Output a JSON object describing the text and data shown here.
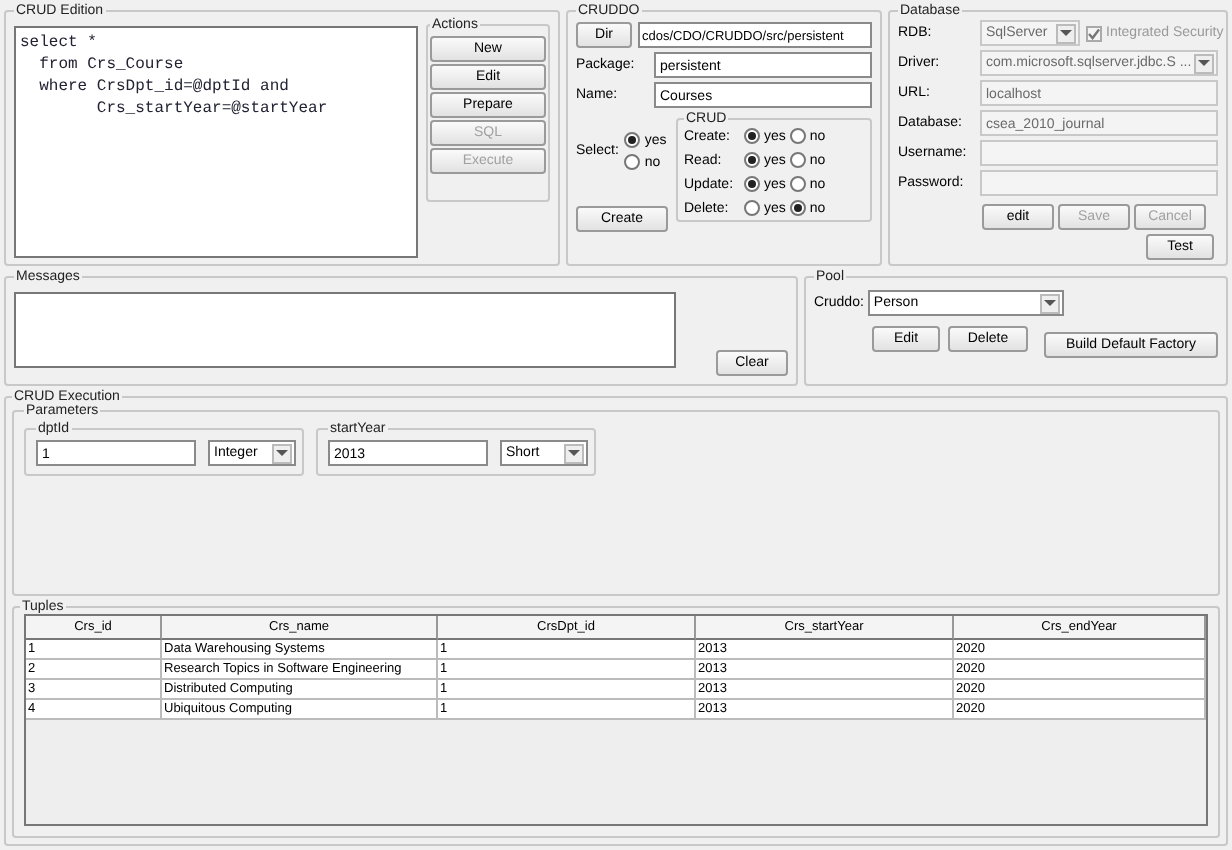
{
  "crud_edition": {
    "title": "CRUD Edition",
    "sql": [
      "select *",
      "  from Crs_Course",
      "  where CrsDpt_id=@dptId and",
      "        Crs_startYear=@startYear"
    ],
    "actions": {
      "title": "Actions",
      "buttons": [
        {
          "label": "New",
          "disabled": false
        },
        {
          "label": "Edit",
          "disabled": false
        },
        {
          "label": "Prepare",
          "disabled": false
        },
        {
          "label": "SQL",
          "disabled": true
        },
        {
          "label": "Execute",
          "disabled": true
        }
      ]
    }
  },
  "cruddo": {
    "title": "CRUDDO",
    "dir_button": "Dir",
    "dir_value": "cdos/CDO/CRUDDO/src/persistent",
    "fields": [
      {
        "label": "Package:",
        "value": "persistent"
      },
      {
        "label": "Name:",
        "value": "Courses"
      }
    ],
    "select": {
      "label": "Select:",
      "options": [
        {
          "label": "yes",
          "selected": true
        },
        {
          "label": "no",
          "selected": false
        }
      ]
    },
    "crud": {
      "title": "CRUD",
      "rows": [
        {
          "label": "Create:",
          "options": [
            {
              "label": "yes",
              "selected": true
            },
            {
              "label": "no",
              "selected": false
            }
          ]
        },
        {
          "label": "Read:",
          "options": [
            {
              "label": "yes",
              "selected": true
            },
            {
              "label": "no",
              "selected": false
            }
          ]
        },
        {
          "label": "Update:",
          "options": [
            {
              "label": "yes",
              "selected": true
            },
            {
              "label": "no",
              "selected": false
            }
          ]
        },
        {
          "label": "Delete:",
          "options": [
            {
              "label": "yes",
              "selected": false
            },
            {
              "label": "no",
              "selected": true
            }
          ]
        }
      ]
    },
    "create_button": "Create"
  },
  "database": {
    "title": "Database",
    "rdb": {
      "label": "RDB:",
      "value": "SqlServer",
      "disabled": true
    },
    "integrated_security": {
      "label": "Integrated Security",
      "checked": true,
      "disabled": true
    },
    "fields": [
      {
        "label": "Driver:",
        "value": "com.microsoft.sqlserver.jdbc.S ...",
        "kind": "select",
        "disabled": true
      },
      {
        "label": "URL:",
        "value": "localhost",
        "kind": "text",
        "disabled": true
      },
      {
        "label": "Database:",
        "value": "csea_2010_journal",
        "kind": "text",
        "disabled": true
      },
      {
        "label": "Username:",
        "kind": "text",
        "disabled": true
      },
      {
        "label": "Password:",
        "kind": "text",
        "disabled": true
      }
    ],
    "buttons": [
      {
        "label": "edit",
        "disabled": false
      },
      {
        "label": "Save",
        "disabled": true
      },
      {
        "label": "Cancel",
        "disabled": true
      }
    ],
    "test_button": "Test"
  },
  "messages": {
    "title": "Messages",
    "clear_button": "Clear"
  },
  "pool": {
    "title": "Pool",
    "label": "Cruddo:",
    "value": "Person",
    "buttons": [
      "Edit",
      "Delete"
    ],
    "build_button": "Build Default Factory"
  },
  "execution": {
    "title": "CRUD Execution",
    "parameters": {
      "title": "Parameters",
      "items": [
        {
          "name": "dptId",
          "value": "1",
          "type": "Integer"
        },
        {
          "name": "startYear",
          "value": "2013",
          "type": "Short"
        }
      ]
    },
    "tuples": {
      "title": "Tuples",
      "columns": [
        "Crs_id",
        "Crs_name",
        "CrsDpt_id",
        "Crs_startYear",
        "Crs_endYear"
      ],
      "rows": [
        [
          "1",
          "Data Warehousing Systems",
          "1",
          "2013",
          "2020"
        ],
        [
          "2",
          "Research Topics in Software Engineering",
          "1",
          "2013",
          "2020"
        ],
        [
          "3",
          "Distributed Computing",
          "1",
          "2013",
          "2020"
        ],
        [
          "4",
          "Ubiquitous Computing",
          "1",
          "2013",
          "2020"
        ]
      ]
    }
  }
}
